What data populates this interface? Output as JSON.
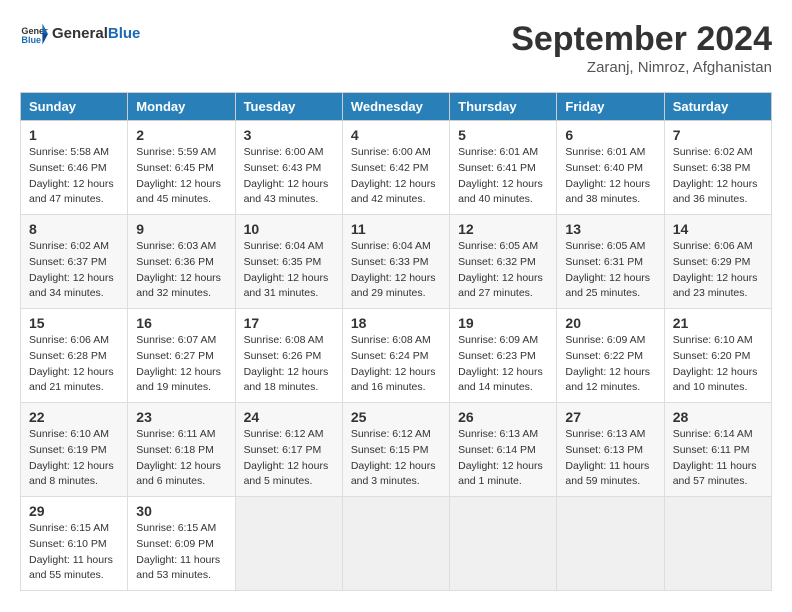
{
  "header": {
    "logo_general": "General",
    "logo_blue": "Blue",
    "title": "September 2024",
    "subtitle": "Zaranj, Nimroz, Afghanistan"
  },
  "columns": [
    "Sunday",
    "Monday",
    "Tuesday",
    "Wednesday",
    "Thursday",
    "Friday",
    "Saturday"
  ],
  "weeks": [
    [
      {
        "day": "1",
        "sunrise": "5:58 AM",
        "sunset": "6:46 PM",
        "daylight": "12 hours and 47 minutes."
      },
      {
        "day": "2",
        "sunrise": "5:59 AM",
        "sunset": "6:45 PM",
        "daylight": "12 hours and 45 minutes."
      },
      {
        "day": "3",
        "sunrise": "6:00 AM",
        "sunset": "6:43 PM",
        "daylight": "12 hours and 43 minutes."
      },
      {
        "day": "4",
        "sunrise": "6:00 AM",
        "sunset": "6:42 PM",
        "daylight": "12 hours and 42 minutes."
      },
      {
        "day": "5",
        "sunrise": "6:01 AM",
        "sunset": "6:41 PM",
        "daylight": "12 hours and 40 minutes."
      },
      {
        "day": "6",
        "sunrise": "6:01 AM",
        "sunset": "6:40 PM",
        "daylight": "12 hours and 38 minutes."
      },
      {
        "day": "7",
        "sunrise": "6:02 AM",
        "sunset": "6:38 PM",
        "daylight": "12 hours and 36 minutes."
      }
    ],
    [
      {
        "day": "8",
        "sunrise": "6:02 AM",
        "sunset": "6:37 PM",
        "daylight": "12 hours and 34 minutes."
      },
      {
        "day": "9",
        "sunrise": "6:03 AM",
        "sunset": "6:36 PM",
        "daylight": "12 hours and 32 minutes."
      },
      {
        "day": "10",
        "sunrise": "6:04 AM",
        "sunset": "6:35 PM",
        "daylight": "12 hours and 31 minutes."
      },
      {
        "day": "11",
        "sunrise": "6:04 AM",
        "sunset": "6:33 PM",
        "daylight": "12 hours and 29 minutes."
      },
      {
        "day": "12",
        "sunrise": "6:05 AM",
        "sunset": "6:32 PM",
        "daylight": "12 hours and 27 minutes."
      },
      {
        "day": "13",
        "sunrise": "6:05 AM",
        "sunset": "6:31 PM",
        "daylight": "12 hours and 25 minutes."
      },
      {
        "day": "14",
        "sunrise": "6:06 AM",
        "sunset": "6:29 PM",
        "daylight": "12 hours and 23 minutes."
      }
    ],
    [
      {
        "day": "15",
        "sunrise": "6:06 AM",
        "sunset": "6:28 PM",
        "daylight": "12 hours and 21 minutes."
      },
      {
        "day": "16",
        "sunrise": "6:07 AM",
        "sunset": "6:27 PM",
        "daylight": "12 hours and 19 minutes."
      },
      {
        "day": "17",
        "sunrise": "6:08 AM",
        "sunset": "6:26 PM",
        "daylight": "12 hours and 18 minutes."
      },
      {
        "day": "18",
        "sunrise": "6:08 AM",
        "sunset": "6:24 PM",
        "daylight": "12 hours and 16 minutes."
      },
      {
        "day": "19",
        "sunrise": "6:09 AM",
        "sunset": "6:23 PM",
        "daylight": "12 hours and 14 minutes."
      },
      {
        "day": "20",
        "sunrise": "6:09 AM",
        "sunset": "6:22 PM",
        "daylight": "12 hours and 12 minutes."
      },
      {
        "day": "21",
        "sunrise": "6:10 AM",
        "sunset": "6:20 PM",
        "daylight": "12 hours and 10 minutes."
      }
    ],
    [
      {
        "day": "22",
        "sunrise": "6:10 AM",
        "sunset": "6:19 PM",
        "daylight": "12 hours and 8 minutes."
      },
      {
        "day": "23",
        "sunrise": "6:11 AM",
        "sunset": "6:18 PM",
        "daylight": "12 hours and 6 minutes."
      },
      {
        "day": "24",
        "sunrise": "6:12 AM",
        "sunset": "6:17 PM",
        "daylight": "12 hours and 5 minutes."
      },
      {
        "day": "25",
        "sunrise": "6:12 AM",
        "sunset": "6:15 PM",
        "daylight": "12 hours and 3 minutes."
      },
      {
        "day": "26",
        "sunrise": "6:13 AM",
        "sunset": "6:14 PM",
        "daylight": "12 hours and 1 minute."
      },
      {
        "day": "27",
        "sunrise": "6:13 AM",
        "sunset": "6:13 PM",
        "daylight": "11 hours and 59 minutes."
      },
      {
        "day": "28",
        "sunrise": "6:14 AM",
        "sunset": "6:11 PM",
        "daylight": "11 hours and 57 minutes."
      }
    ],
    [
      {
        "day": "29",
        "sunrise": "6:15 AM",
        "sunset": "6:10 PM",
        "daylight": "11 hours and 55 minutes."
      },
      {
        "day": "30",
        "sunrise": "6:15 AM",
        "sunset": "6:09 PM",
        "daylight": "11 hours and 53 minutes."
      },
      null,
      null,
      null,
      null,
      null
    ]
  ]
}
